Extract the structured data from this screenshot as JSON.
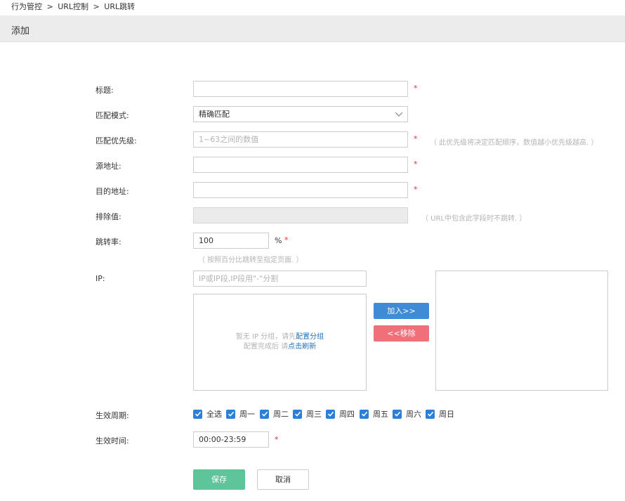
{
  "breadcrumb": [
    "行为管控",
    ">",
    "URL控制",
    ">",
    "URL跳转"
  ],
  "header": {
    "title": "添加"
  },
  "form": {
    "title": {
      "label": "标题:",
      "value": "",
      "required": "*"
    },
    "match_mode": {
      "label": "匹配模式:",
      "value": "精确匹配"
    },
    "priority": {
      "label": "匹配优先级:",
      "placeholder": "1~63之间的数值",
      "required": "*",
      "hint": "（ 此优先级将决定匹配顺序，数值越小优先级越高. ）"
    },
    "source": {
      "label": "源地址:",
      "value": "",
      "required": "*"
    },
    "destination": {
      "label": "目的地址:",
      "value": "",
      "required": "*"
    },
    "exclude": {
      "label": "排除值:",
      "value": "",
      "hint": "（ URL中包含此字段时不跳转. ）"
    },
    "redirect_rate": {
      "label": "跳转率:",
      "value": "100",
      "unit": "%",
      "required": "*",
      "hint": "（ 按照百分比跳转至指定页面. ）"
    },
    "ip": {
      "label": "IP:",
      "placeholder": "IP或IP段,IP段用\"-\"分割",
      "empty_line1_prefix": "暂无 IP 分组，请先",
      "empty_line1_link": "配置分组",
      "empty_line2_prefix": "配置完成后 请",
      "empty_line2_link": "点击刷新",
      "add_button": "加入>>",
      "remove_button": "<<移除"
    },
    "period": {
      "label": "生效周期:",
      "options": [
        {
          "label": "全选",
          "checked": true
        },
        {
          "label": "周一",
          "checked": true
        },
        {
          "label": "周二",
          "checked": true
        },
        {
          "label": "周三",
          "checked": true
        },
        {
          "label": "周四",
          "checked": true
        },
        {
          "label": "周五",
          "checked": true
        },
        {
          "label": "周六",
          "checked": true
        },
        {
          "label": "周日",
          "checked": true
        }
      ]
    },
    "time": {
      "label": "生效时间:",
      "value": "00:00-23:59",
      "required": "*"
    }
  },
  "actions": {
    "save": "保存",
    "cancel": "取消"
  },
  "colors": {
    "accent": "#3f8bd6",
    "danger": "#f0707a",
    "save": "#5ec59a",
    "required": "#e2302c"
  }
}
